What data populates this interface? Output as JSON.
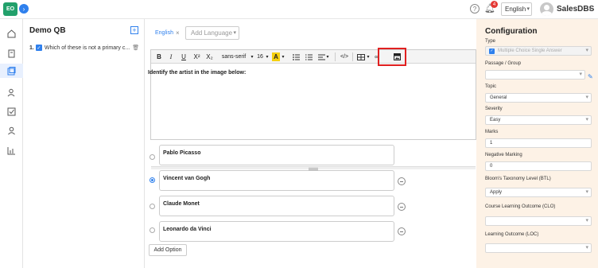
{
  "app": {
    "logo_text": "EO",
    "toggle_icon": "›",
    "notifications_count": "4",
    "language": "English",
    "account_name": "SalesDBS"
  },
  "question_bank": {
    "title": "Demo QB",
    "questions": [
      {
        "number": "1.",
        "text": "Which of these is not a primary c..."
      }
    ]
  },
  "editor": {
    "language_tab": "English",
    "add_language_placeholder": "Add Language",
    "toolbar": {
      "bold": "B",
      "italic": "I",
      "underline": "U",
      "superscript": "X²",
      "subscript": "X₂",
      "font_family": "sans-serif",
      "font_size": "16",
      "text_color": "A",
      "code": "</>"
    },
    "content": "Identify the artist in the image below:"
  },
  "options": [
    {
      "text": "Pablo Picasso",
      "selected": false
    },
    {
      "text": "Vincent van Gogh",
      "selected": true
    },
    {
      "text": "Claude Monet",
      "selected": false
    },
    {
      "text": "Leonardo da Vinci",
      "selected": false
    }
  ],
  "add_option_label": "Add Option",
  "configuration": {
    "title": "Configuration",
    "type_label": "Type",
    "type_value": "Multiple Choice Single Answer",
    "passage_label": "Passage / Group",
    "passage_value": "",
    "topic_label": "Topic",
    "topic_value": "General",
    "severity_label": "Severity",
    "severity_value": "Easy",
    "marks_label": "Marks",
    "marks_value": "1",
    "negative_marking_label": "Negative Marking",
    "negative_marking_value": "0",
    "btl_label": "Bloom's Taxonomy Level (BTL)",
    "btl_value": "Apply",
    "clo_label": "Course Learning Outcome (CLO)",
    "clo_value": "",
    "loc_label": "Learning Outcome (LOC)",
    "loc_value": ""
  },
  "colors": {
    "accent": "#2f80ed",
    "logo": "#22a06b",
    "highlight": "#e02020",
    "config_bg": "#fdf2e6"
  }
}
